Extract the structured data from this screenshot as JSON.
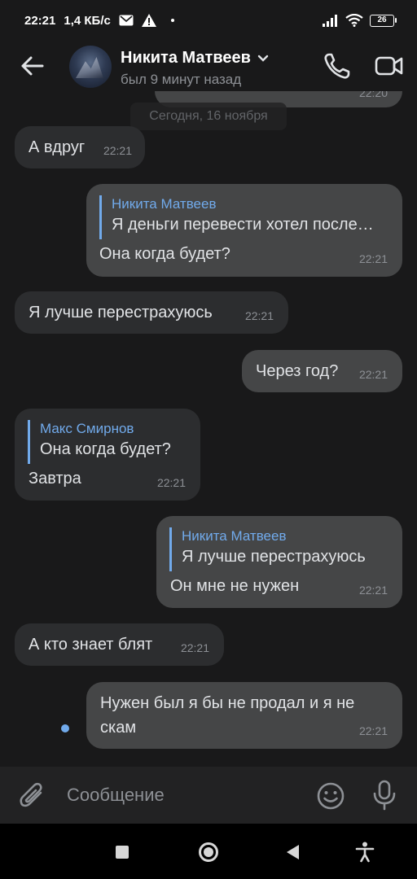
{
  "status_bar": {
    "time": "22:21",
    "speed": "1,4 КБ/с",
    "battery": "26"
  },
  "header": {
    "name": "Никита Матвеев",
    "status": "был 9 минут назад"
  },
  "chat": {
    "prev_time": "22:20",
    "date_separator": "Сегодня, 16 ноября",
    "messages": [
      {
        "text": "А вдруг",
        "time": "22:21"
      },
      {
        "reply_name": "Никита Матвеев",
        "reply_text": "Я деньги перевести хотел после…",
        "text": "Она когда будет?",
        "time": "22:21"
      },
      {
        "text": "Я лучше перестрахуюсь",
        "time": "22:21"
      },
      {
        "text": "Через год?",
        "time": "22:21"
      },
      {
        "reply_name": "Макс Смирнов",
        "reply_text": "Она когда будет?",
        "text": "Завтра",
        "time": "22:21"
      },
      {
        "reply_name": "Никита Матвеев",
        "reply_text": "Я лучше перестрахуюсь",
        "text": "Он мне не нужен",
        "time": "22:21"
      },
      {
        "text": "А кто знает блят",
        "time": "22:21"
      },
      {
        "text_line1": "Нужен был я бы не продал и я не",
        "text_line2": "скам",
        "time": "22:21"
      }
    ]
  },
  "input": {
    "placeholder": "Сообщение"
  },
  "colors": {
    "background": "#19191a",
    "bubble_in": "#2c2d2f",
    "bubble_out": "#454647",
    "accent": "#71aaeb"
  }
}
